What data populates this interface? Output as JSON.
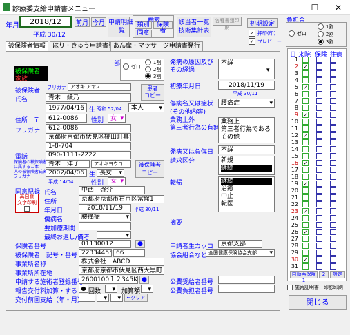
{
  "window": {
    "title": "診療委支給申請書メニュー",
    "minimize": "—",
    "maximize": "☐",
    "close": "✕"
  },
  "header": {
    "year_label": "年月",
    "year_value": "2018/12",
    "era_value": "平成 30/12",
    "prev_month": "前月",
    "this_month": "今月",
    "statement_list": "申請明細\n一覧",
    "search_label": "検索",
    "search_type": "類別",
    "search_insurer": "保険者",
    "search_consent": "同意",
    "submit_list": "該当者一覧\n技術集計表",
    "form_print": "各種書類印刷",
    "initial_settings": "初期設定",
    "seal_print": "押印(印)",
    "preview": "プレビュー",
    "burden_label": "負担金",
    "burden_options": [
      "ゼロ",
      "1割",
      "2割",
      "3割"
    ]
  },
  "tabs": [
    "被保険者情報",
    "はり・きゅう申請書発行",
    "あん摩・マッサージ申請書発行"
  ],
  "insured": {
    "status_label1": "被保険者",
    "status_label2": "家族",
    "insured_person": "被保険者",
    "name_label": "氏名",
    "furigana_label": "フリガナ",
    "furigana_value": "アオキ アヤノ",
    "name_value": "青木　綾乃",
    "consent_copy": "患者\nコピー",
    "birth_value": "1977/04/16",
    "birth_label": "生",
    "birth_era": "昭和 52/04",
    "relation_value": "本人",
    "address_label": "住所",
    "postal_mark": "〒",
    "postal_value": "612-0086",
    "sex_label": "性別",
    "sex_value": "女",
    "furigana2_label": "フリガナ",
    "furigana2_value": "612-0086",
    "address_value": "京都府京都市伏見区桃山町真斎",
    "address2_value": "1-8-704",
    "phone_label": "電話",
    "phone_value": "090-1111-2222",
    "family_note": "保険者の被保険者\nに属するご本\n人の被保険者氏名\nフリガナ",
    "family_name": "青木　洋子",
    "family_furigana": "アオキヨウコ",
    "family_birth": "2002/04/06",
    "family_birth_label": "生",
    "family_relation": "長女",
    "family_era": "平成 14/04",
    "family_sex_label": "性別",
    "family_sex": "女",
    "fam_copy": "被保険者\nコピー"
  },
  "partial": {
    "label": "一部負担金",
    "options": [
      "ゼロ",
      "1割",
      "2割",
      "3割"
    ]
  },
  "cause": {
    "label": "発病の原因及び\nその経過",
    "value": "不詳",
    "first_date_label": "初療年月日",
    "first_date": "2018/11/19",
    "first_era": "平成 30/11",
    "injury_label": "傷病名又は症状\n(その他内容)",
    "injury_value": "腰痛症",
    "other_label": "業務上外\n第三者行為の有無",
    "other_items": [
      "業務上",
      "第三者行為である",
      "その他"
    ],
    "onset_label": "発病又は負傷日",
    "onset_value": "不詳",
    "claim_label": "請求区分",
    "claim_items": [
      "新規",
      "継続"
    ],
    "outcome_label": "転帰",
    "outcome_items": [
      "継続",
      "治癒",
      "中止",
      "転医"
    ]
  },
  "doctor": {
    "consent_record": "同意記録",
    "retry_label": "再同意\n文字印刷",
    "name_label": "氏名",
    "name_value": "中西　啓介",
    "address_label": "住所",
    "address_value": "京都府京都市右京区常盤1",
    "date_label": "年月日",
    "date_value": "2018/11/19",
    "date_era": "平成 30/11",
    "injury_label": "傷病名",
    "injury_value": "腰痛症",
    "consent_period": "要加療期間",
    "last_consent": "最終お返し/備考",
    "remarks_label": "摘要"
  },
  "insurer": {
    "number_label": "保険者番号",
    "number_value": "01130012",
    "symbol_label": "被保険者　記号・番号",
    "symbol_value": "22334455",
    "symbol_no": "66",
    "office_label": "事業所名称",
    "office_value": "株式会社　ABCD",
    "office_addr_label": "事業所所在地",
    "office_addr_value": "京都府京都市伏見区西大黒町２３",
    "reg_label": "申請する施術者登録番号",
    "reg_value": "2600100１２345KF",
    "report_label": "報告交付料加算・する",
    "report_count": "回数",
    "report_add": "加算額",
    "last_label": "交付前回支給（年・月）",
    "clear": "←クリア",
    "applicant_label": "申請者生カッコ",
    "applicant_value": "京都支部",
    "assoc_label": "協会組合など",
    "assoc_value": "全国健康保険協会支部",
    "public_label": "公費受給者番号",
    "public2_label": "公費負担者番号"
  },
  "calendar": {
    "headers": [
      "日",
      "来院",
      "保険",
      "往療"
    ],
    "days": [
      "1",
      "2",
      "3",
      "4",
      "5",
      "6",
      "7",
      "8",
      "9",
      "10",
      "11",
      "12",
      "13",
      "14",
      "15",
      "16",
      "17",
      "18",
      "19",
      "20",
      "21",
      "22",
      "23",
      "24",
      "25",
      "26",
      "27",
      "28",
      "29",
      "30",
      "31"
    ],
    "visited": [
      2,
      5,
      9,
      12,
      16,
      19,
      23,
      26,
      30
    ],
    "auto_btn": "自動再保険 1",
    "btn2": "2",
    "btn3": "設定"
  },
  "footer": {
    "print_label": "施術証明書　印影印刷",
    "close": "閉じる"
  }
}
